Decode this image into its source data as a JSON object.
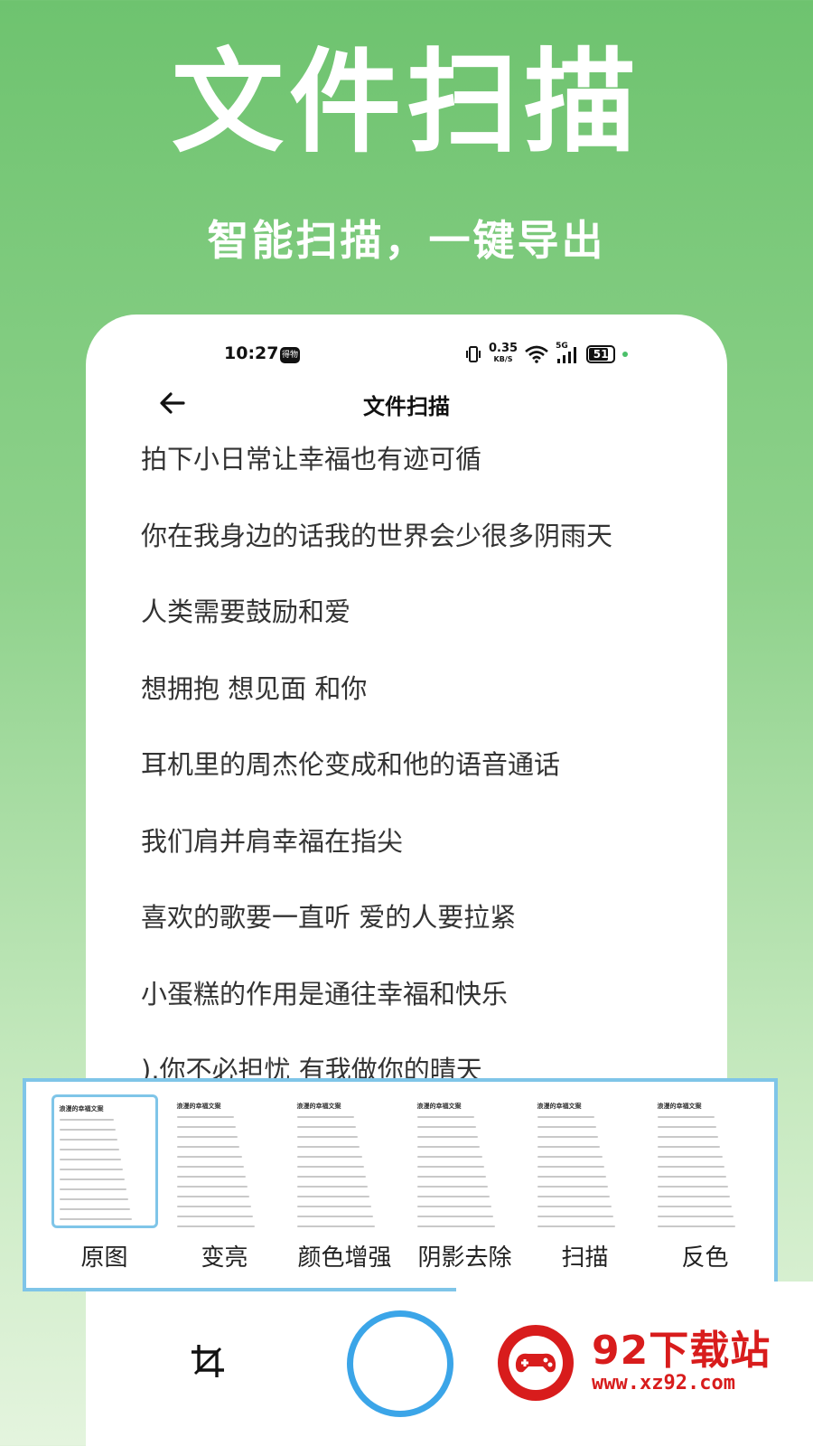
{
  "hero": {
    "title": "文件扫描",
    "subtitle": "智能扫描，一键导出"
  },
  "status_bar": {
    "time": "10:27",
    "badge": "得物",
    "speed_value": "0.35",
    "speed_unit": "KB/S",
    "network": "5G",
    "battery": "51"
  },
  "nav": {
    "title": "文件扫描",
    "back_icon": "arrow-left-icon"
  },
  "document_lines": [
    "拍下小日常让幸福也有迹可循",
    "你在我身边的话我的世界会少很多阴雨天",
    "人类需要鼓励和爱",
    "想拥抱 想见面 和你",
    "耳机里的周杰伦变成和他的语音通话",
    "我们肩并肩幸福在指尖",
    "喜欢的歌要一直听 爱的人要拉紧",
    "小蛋糕的作用是通往幸福和快乐",
    ").你不必担忧 有我做你的晴天"
  ],
  "filters": {
    "thumb_title": "浪漫的幸福文案",
    "items": [
      {
        "label": "原图",
        "selected": true
      },
      {
        "label": "变亮",
        "selected": false
      },
      {
        "label": "颜色增强",
        "selected": false
      },
      {
        "label": "阴影去除",
        "selected": false
      },
      {
        "label": "扫描",
        "selected": false
      },
      {
        "label": "反色",
        "selected": false
      }
    ]
  },
  "bottom": {
    "crop_icon": "crop-icon",
    "shutter_icon": "shutter-button"
  },
  "watermark": {
    "name": "92下载站",
    "url": "www.xz92.com"
  },
  "colors": {
    "accent_blue": "#3ba5e8",
    "panel_border": "#7fc5e8",
    "green_top": "#6ec36f",
    "watermark_red": "#d81c1c"
  }
}
